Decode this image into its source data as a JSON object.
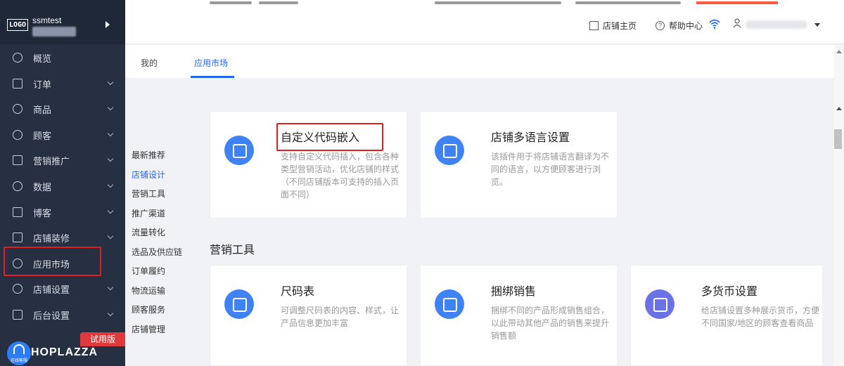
{
  "sidebar": {
    "logo": "LOGO",
    "store_name": "ssmtest",
    "items": [
      {
        "label": "概览",
        "icon": "compass-icon"
      },
      {
        "label": "订单",
        "icon": "order-icon"
      },
      {
        "label": "商品",
        "icon": "box-icon"
      },
      {
        "label": "顾客",
        "icon": "users-icon"
      },
      {
        "label": "营销推广",
        "icon": "megaphone-icon"
      },
      {
        "label": "数据",
        "icon": "chart-icon"
      },
      {
        "label": "博客",
        "icon": "document-icon"
      },
      {
        "label": "店铺装修",
        "icon": "layout-icon"
      },
      {
        "label": "应用市场",
        "icon": "wrench-icon"
      },
      {
        "label": "店铺设置",
        "icon": "gear-icon"
      },
      {
        "label": "后台设置",
        "icon": "monitor-icon"
      }
    ],
    "trial_badge": "试用版",
    "support_label": "在线客服",
    "brand_text": "HOPLAZZA"
  },
  "header": {
    "store_home": "店铺主页",
    "help_center": "帮助中心"
  },
  "tabs": [
    {
      "label": "我的"
    },
    {
      "label": "应用市场"
    }
  ],
  "categories": [
    {
      "label": "最新推荐"
    },
    {
      "label": "店铺设计"
    },
    {
      "label": "营销工具"
    },
    {
      "label": "推广渠道"
    },
    {
      "label": "流量转化"
    },
    {
      "label": "选品及供应链"
    },
    {
      "label": "订单履约"
    },
    {
      "label": "物流运输"
    },
    {
      "label": "顾客服务"
    },
    {
      "label": "店铺管理"
    }
  ],
  "cards": [
    {
      "title": "自定义代码嵌入",
      "desc": "支持自定义代码插入，包含各种类型营销活动，优化店铺的样式（不同店铺版本可支持的插入页面不同）",
      "icon": "code-icon"
    },
    {
      "title": "店铺多语言设置",
      "desc": "该插件用于将店铺语言翻译为不同的语言，以方便顾客进行浏览。",
      "icon": "translate-icon"
    },
    {
      "title": "尺码表",
      "desc": "可调整尺码表的内容、样式，让产品信息更加丰富",
      "icon": "ruler-icon"
    },
    {
      "title": "捆绑销售",
      "desc": "捆绑不同的产品形成销售组合，以此带动其他产品的销售来提升销售额",
      "icon": "layers-icon"
    },
    {
      "title": "多货币设置",
      "desc": "给店铺设置多种展示货币，方便不同国家/地区的顾客查看商品",
      "icon": "currency-icon"
    }
  ],
  "section_marketing": "营销工具",
  "colors": {
    "accent": "#2467ea",
    "sidebar": "#263042",
    "highlight": "#e02020"
  }
}
